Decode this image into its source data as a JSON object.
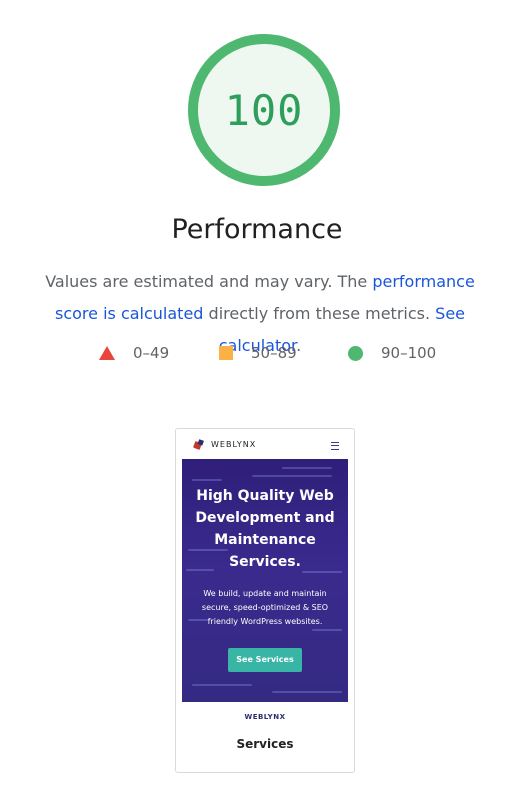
{
  "gauge": {
    "score": "100",
    "fraction": 1.0,
    "color": "#4fb870",
    "fill_color": "#eef8f1"
  },
  "category": {
    "title": "Performance"
  },
  "description": {
    "text_1": "Values are estimated and may vary. The ",
    "link_1": "performance score is calculated",
    "text_2": " directly from these metrics. ",
    "link_2": "See calculator",
    "text_3": "."
  },
  "legend": [
    {
      "icon": "triangle-fail-icon",
      "label": "0–49",
      "color": "#e8453c"
    },
    {
      "icon": "square-average-icon",
      "label": "50–89",
      "color": "#fbb144"
    },
    {
      "icon": "circle-pass-icon",
      "label": "90–100",
      "color": "#4fb870"
    }
  ],
  "screenshot": {
    "brand": "WEBLYNX",
    "hero_title": "High Quality Web Development and Maintenance Services.",
    "hero_text": "We build, update and maintain secure, speed-optimized & SEO friendly WordPress websites.",
    "hero_button": "See Services",
    "footer_brand": "WEBLYNX",
    "section_title": "Services"
  }
}
